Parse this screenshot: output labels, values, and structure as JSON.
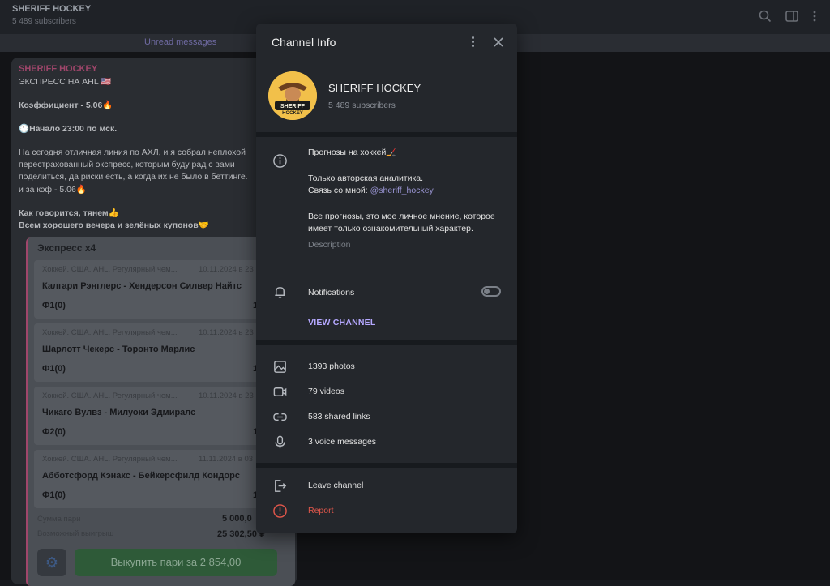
{
  "topbar": {
    "title": "SHERIFF HOCKEY",
    "subscribers": "5 489 subscribers",
    "icons": [
      "search-icon",
      "sidebar-toggle-icon",
      "more-vert-icon"
    ]
  },
  "unread_label": "Unread messages",
  "message": {
    "sender": "SHERIFF HOCKEY",
    "lines": [
      "ЭКСПРЕСС НА AHL 🇺🇸",
      "Коэффициент - 5.06🔥",
      "🕚Начало 23:00 по мск.",
      "На сегодня отличная линия по АХЛ, и я собрал неплохой",
      "перестрахованный экспресс, которым буду рад с вами",
      "поделиться, да риски есть, а когда их не было в беттинге.",
      "и за кэф - 5.06🔥",
      "Как говорится, тянем👍",
      "Всем хорошего вечера и зелёных купонов🤝"
    ]
  },
  "bet_card": {
    "title": "Экспресс x4",
    "events": [
      {
        "meta": "Хоккей. США. AHL. Регулярный чем...",
        "date": "10.11.2024 в 23",
        "name": "Калгари Рэнглерс - Хендерсон Силвер Найтс",
        "bet": "Ф1(0)",
        "odd": "1."
      },
      {
        "meta": "Хоккей. США. AHL. Регулярный чем...",
        "date": "10.11.2024 в 23",
        "name": "Шарлотт Чекерс - Торонто Марлис",
        "bet": "Ф1(0)",
        "odd": "1"
      },
      {
        "meta": "Хоккей. США. AHL. Регулярный чем...",
        "date": "10.11.2024 в 23",
        "name": "Чикаго Вулвз - Милуоки Эдмиралс",
        "bet": "Ф2(0)",
        "odd": "1"
      },
      {
        "meta": "Хоккей. США. AHL. Регулярный чем...",
        "date": "11.11.2024 в 03",
        "name": "Абботсфорд Кэнакс - Бейкерсфилд Кондорс",
        "bet": "Ф1(0)",
        "odd": "1"
      }
    ],
    "sum_label": "Сумма пари",
    "sum_value": "5 000,0",
    "win_label": "Возможный выигрыш",
    "win_value": "25 302,50 ₽",
    "cashout_label": "Выкупить пари за  2 854,00"
  },
  "modal": {
    "title": "Channel Info",
    "channel_name": "SHERIFF HOCKEY",
    "subscribers": "5 489 subscribers",
    "avatar_text": "SHERIFF HOCKEY",
    "description_lines": [
      "Прогнозы на хоккей🏒",
      "Только авторская аналитика.",
      "Связь со мной: ",
      "Все прогнозы, это мое личное мнение, которое имеет только ознакомительный характер."
    ],
    "contact_link": "@sheriff_hockey",
    "description_caption": "Description",
    "notifications_label": "Notifications",
    "notifications_enabled": false,
    "view_channel_label": "VIEW CHANNEL",
    "media": [
      {
        "icon": "photo-icon",
        "label": "1393 photos"
      },
      {
        "icon": "video-icon",
        "label": "79 videos"
      },
      {
        "icon": "link-icon",
        "label": "583 shared links"
      },
      {
        "icon": "microphone-icon",
        "label": "3 voice messages"
      }
    ],
    "leave_label": "Leave channel",
    "report_label": "Report",
    "colors": {
      "accent": "#b5a8ff",
      "danger": "#e2574b",
      "link": "#9a95d4"
    }
  }
}
